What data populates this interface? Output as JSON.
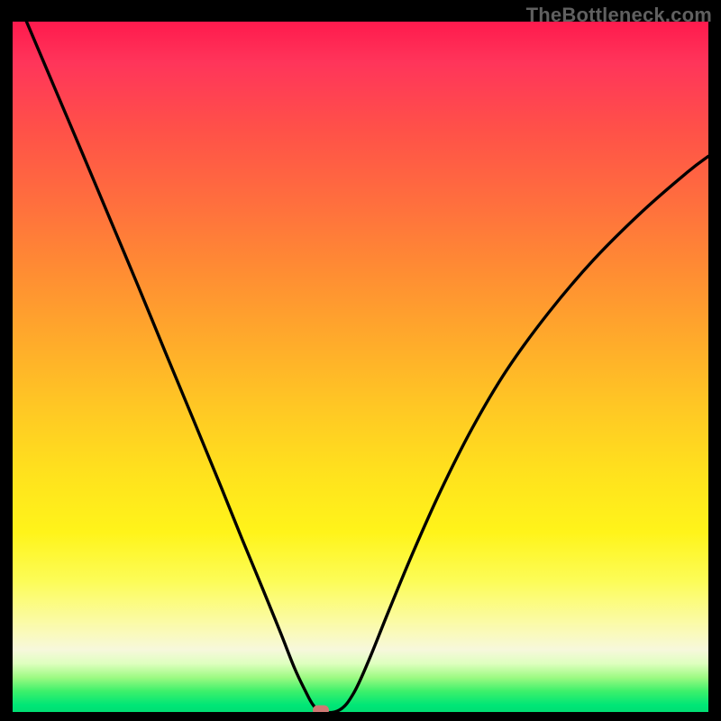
{
  "watermark_text": "TheBottleneck.com",
  "chart_data": {
    "type": "line",
    "title": "",
    "xlabel": "",
    "ylabel": "",
    "xlim": [
      0,
      1
    ],
    "ylim": [
      0,
      1
    ],
    "axes_visible": false,
    "background": "rainbow-vertical-gradient",
    "gradient_stops": [
      {
        "pos": 0.0,
        "color": "#ff1a4d"
      },
      {
        "pos": 0.16,
        "color": "#ff5248"
      },
      {
        "pos": 0.36,
        "color": "#ff8c33"
      },
      {
        "pos": 0.56,
        "color": "#ffc824"
      },
      {
        "pos": 0.74,
        "color": "#fff41a"
      },
      {
        "pos": 0.87,
        "color": "#fbfba6"
      },
      {
        "pos": 0.95,
        "color": "#9dfa83"
      },
      {
        "pos": 1.0,
        "color": "#00df73"
      }
    ],
    "series": [
      {
        "name": "bottleneck-curve",
        "color": "#000000",
        "x": [
          0.02,
          0.06,
          0.1,
          0.14,
          0.18,
          0.22,
          0.26,
          0.3,
          0.33,
          0.36,
          0.385,
          0.405,
          0.42,
          0.432,
          0.445,
          0.47,
          0.49,
          0.512,
          0.54,
          0.575,
          0.615,
          0.66,
          0.71,
          0.77,
          0.835,
          0.905,
          0.97,
          1.0
        ],
        "y": [
          1.0,
          0.905,
          0.81,
          0.714,
          0.618,
          0.52,
          0.423,
          0.325,
          0.25,
          0.177,
          0.115,
          0.064,
          0.032,
          0.01,
          0.0,
          0.003,
          0.027,
          0.075,
          0.145,
          0.23,
          0.32,
          0.41,
          0.495,
          0.578,
          0.655,
          0.725,
          0.782,
          0.805
        ]
      }
    ],
    "marker": {
      "x": 0.443,
      "y": 0.002,
      "color": "#cf7873",
      "shape": "pill"
    }
  }
}
